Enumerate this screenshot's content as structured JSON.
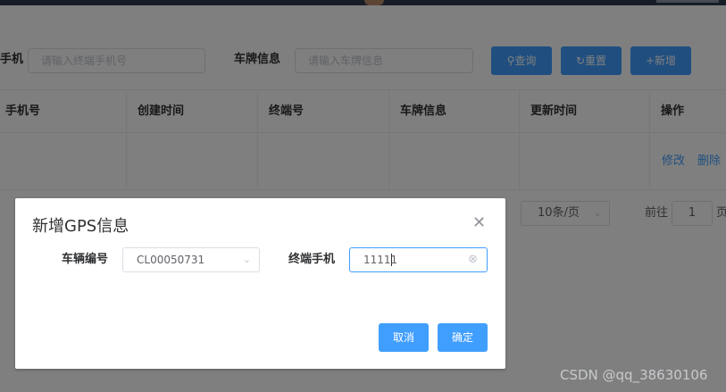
{
  "search": {
    "phone_label": "手机",
    "phone_placeholder": "请输入终端手机号",
    "plate_label": "车牌信息",
    "plate_placeholder": "请输入车牌信息",
    "query_label": "查询",
    "reset_label": "重置",
    "add_label": "新增"
  },
  "table": {
    "headers": [
      "手机号",
      "创建时间",
      "终端号",
      "车牌信息",
      "更新时间",
      "操作"
    ],
    "actions": {
      "edit": "修改",
      "delete": "删除"
    }
  },
  "pagination": {
    "page_size": "10条/页",
    "goto_label": "前往",
    "page_number": "1",
    "page_suffix": "页"
  },
  "dialog": {
    "title": "新增GPS信息",
    "vehicle_label": "车辆编号",
    "vehicle_value": "CL00050731",
    "phone_label": "终端手机",
    "phone_value": "11111",
    "cancel_label": "取消",
    "confirm_label": "确定"
  },
  "watermark": "CSDN @qq_38630106",
  "icons": {
    "search": "search-icon",
    "refresh": "refresh-icon",
    "plus": "plus-icon",
    "close": "close-icon",
    "chevron": "chevron-down-icon",
    "clear": "clear-circle-icon"
  },
  "colors": {
    "primary": "#409eff",
    "header_bar": "#2f3b4f"
  }
}
